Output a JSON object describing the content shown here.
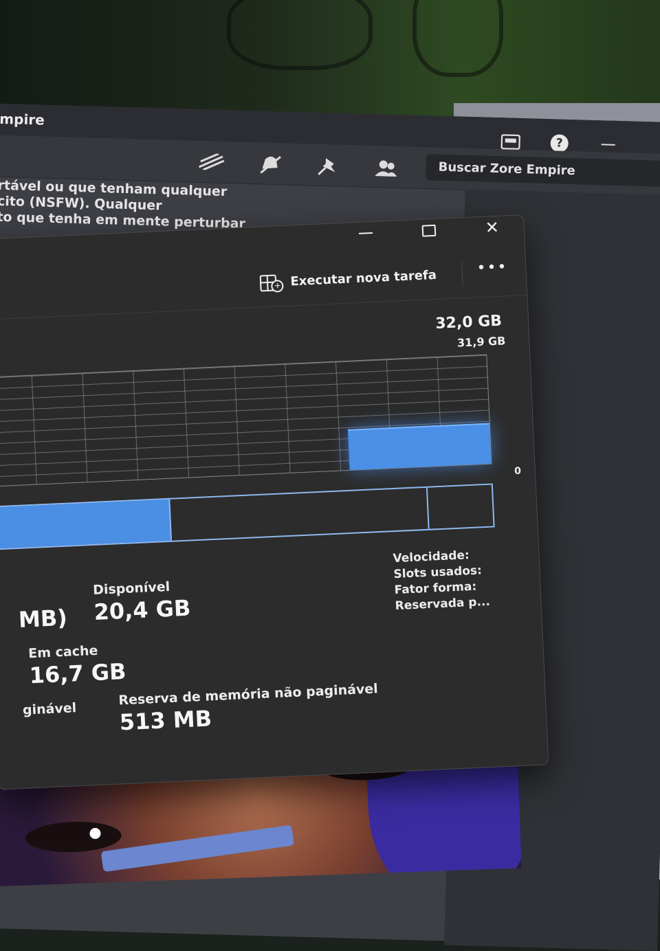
{
  "discord": {
    "server_name": "mpire",
    "search_placeholder": "Buscar Zore Empire",
    "message_lines": [
      "rtável ou que tenham qualquer",
      "cito (NSFW). Qualquer",
      "to que tenha em mente perturbar"
    ],
    "help_glyph": "?",
    "icons": [
      "inbox-icon",
      "help-icon",
      "minimize-icon",
      "threads-icon",
      "mute-icon",
      "pin-icon",
      "members-icon"
    ]
  },
  "taskmgr": {
    "run_new_task": "Executar nova tarefa",
    "more": "•••",
    "total_memory": "32,0 GB",
    "graph_max": "31,9 GB",
    "graph_min": "0",
    "memory_usage_fraction": 0.36,
    "composition_used_fraction": 0.36,
    "composition_standby_end_fraction": 0.87,
    "stats": {
      "in_use_value_partial": "MB)",
      "available_label": "Disponível",
      "available_value": "20,4 GB",
      "cached_label": "Em cache",
      "cached_value": "16,7 GB",
      "paged_label_partial": "ginável",
      "nonpaged_label": "Reserva de memória não paginável",
      "nonpaged_value": "513 MB"
    },
    "right_labels": [
      "Velocidade:",
      "Slots usados:",
      "Fator forma:",
      "Reservada p..."
    ],
    "accent_color": "#4a90e6"
  }
}
